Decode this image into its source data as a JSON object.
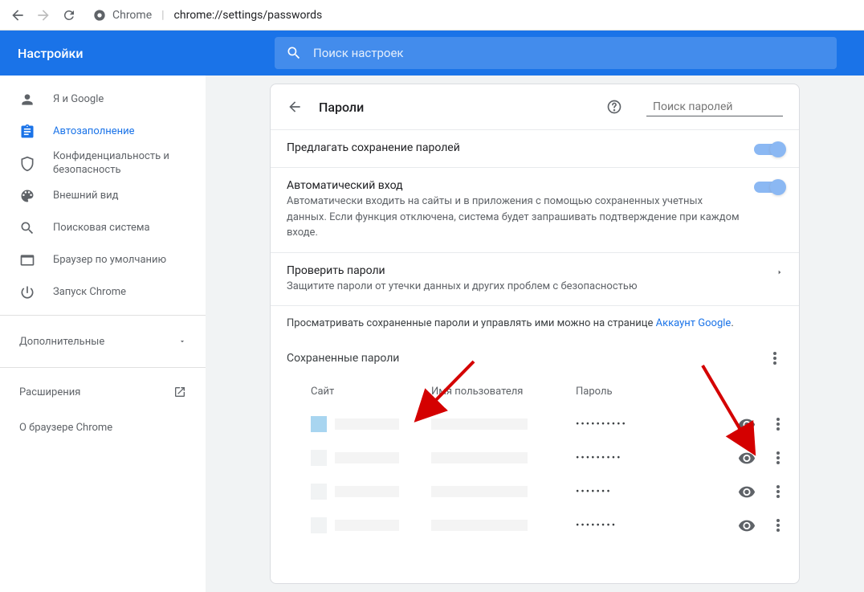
{
  "browser": {
    "chrome_label": "Chrome",
    "url": "chrome://settings/passwords"
  },
  "header": {
    "title": "Настройки",
    "search_placeholder": "Поиск настроек"
  },
  "sidebar": {
    "items": [
      {
        "label": "Я и Google"
      },
      {
        "label": "Автозаполнение"
      },
      {
        "label": "Конфиденциальность и безопасность"
      },
      {
        "label": "Внешний вид"
      },
      {
        "label": "Поисковая система"
      },
      {
        "label": "Браузер по умолчанию"
      },
      {
        "label": "Запуск Chrome"
      }
    ],
    "advanced": "Дополнительные",
    "extensions": "Расширения",
    "about": "О браузере Chrome"
  },
  "page": {
    "title": "Пароли",
    "search_placeholder": "Поиск паролей",
    "offer_save": {
      "title": "Предлагать сохранение паролей"
    },
    "auto_signin": {
      "title": "Автоматический вход",
      "desc": "Автоматически входить на сайты и в приложения с помощью сохраненных учетных данных. Если функция отключена, система будет запрашивать подтверждение при каждом входе."
    },
    "check_passwords": {
      "title": "Проверить пароли",
      "desc": "Защитите пароли от утечки данных и других проблем с безопасностью"
    },
    "manage_info_prefix": "Просматривать сохраненные пароли и управлять ими можно на странице ",
    "manage_info_link": "Аккаунт Google",
    "manage_info_suffix": ".",
    "saved_title": "Сохраненные пароли",
    "columns": {
      "site": "Сайт",
      "user": "Имя пользователя",
      "pass": "Пароль"
    },
    "rows": [
      {
        "password_mask": "••••••••••"
      },
      {
        "password_mask": "•••••••••"
      },
      {
        "password_mask": "•••••••"
      },
      {
        "password_mask": "••••••••"
      }
    ]
  }
}
